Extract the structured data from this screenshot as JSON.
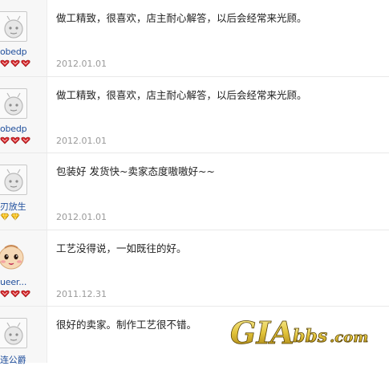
{
  "reviews": [
    {
      "username": "obedp",
      "comment": "做工精致，很喜欢，店主耐心解答，以后会经常来光顾。",
      "date": "2012.01.01",
      "badge": "heart"
    },
    {
      "username": "obedp",
      "comment": "做工精致，很喜欢，店主耐心解答，以后会经常来光顾。",
      "date": "2012.01.01",
      "badge": "heart"
    },
    {
      "username": "刃放生",
      "comment": "包装好 发货快~卖家态度嗷嗷好~~",
      "date": "2012.01.01",
      "badge": "diamond"
    },
    {
      "username": "ueer...",
      "comment": "工艺没得说，一如既往的好。",
      "date": "2011.12.31",
      "badge": "heart"
    },
    {
      "username": "连公爵",
      "comment": "很好的卖家。制作工艺很不错。",
      "date": "",
      "badge": "none"
    }
  ],
  "watermark": {
    "text": "GIAbbs.com"
  },
  "colors": {
    "heart": "#d6262a",
    "diamond": "#f2b400",
    "link": "#1f4e9c",
    "date": "#9a9a9a"
  }
}
